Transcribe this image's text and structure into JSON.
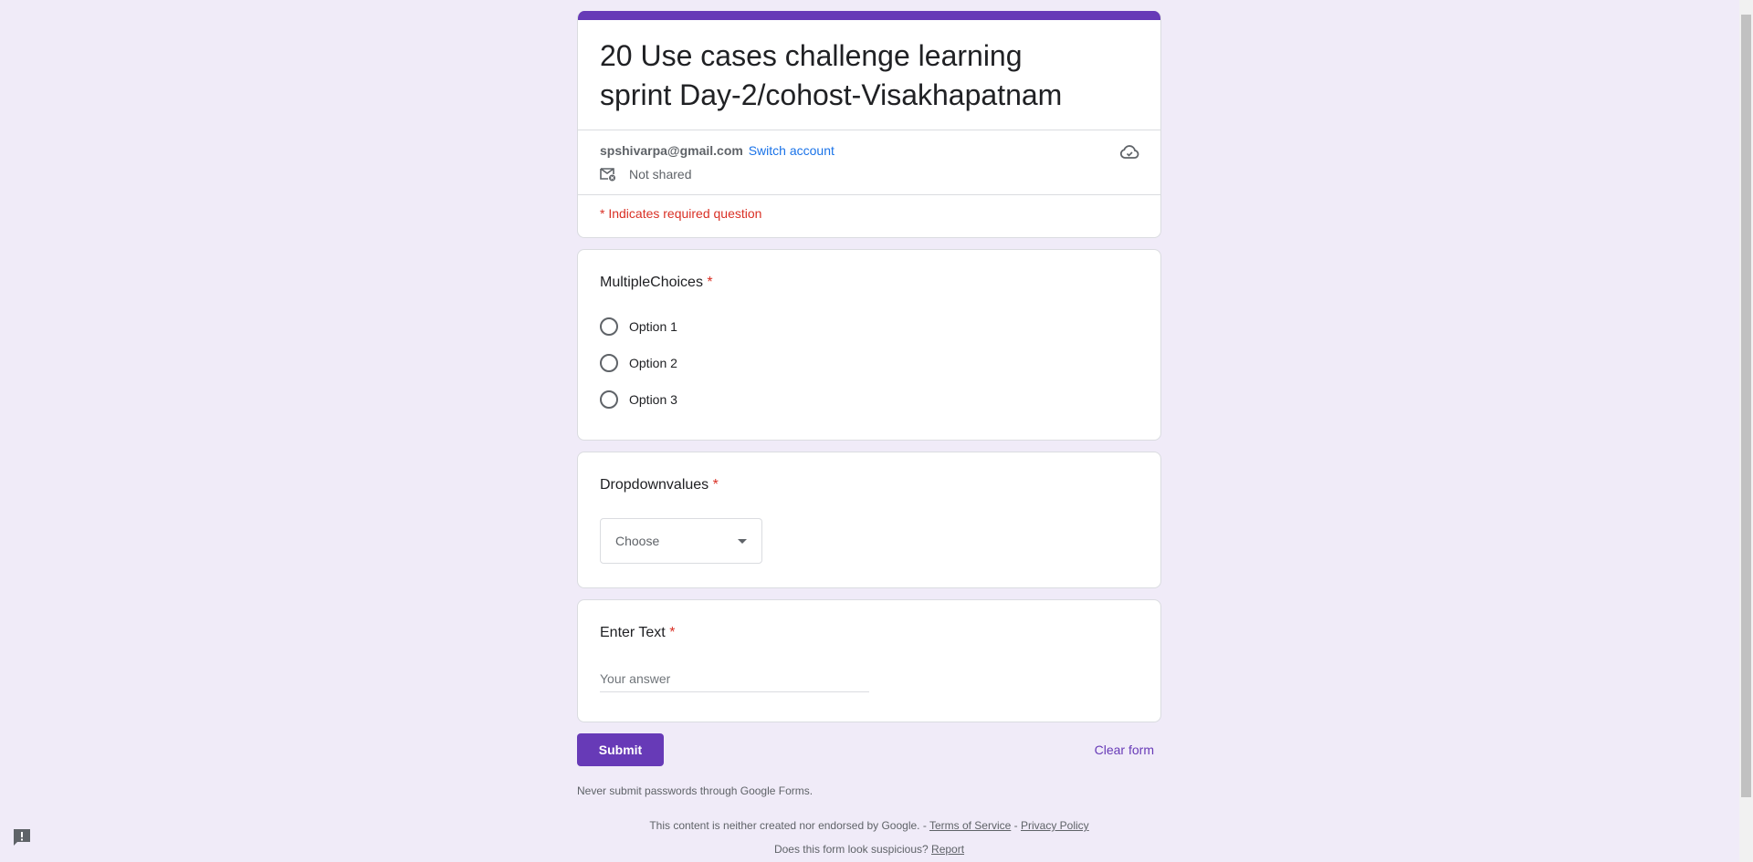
{
  "form": {
    "title": "20 Use cases challenge learning sprint Day-2/cohost-Visakhapatnam",
    "account_email": "spshivarpa@gmail.com",
    "switch_account": "Switch account",
    "shared_status": "Not shared",
    "required_note": "* Indicates required question",
    "accent_color": "#673ab7"
  },
  "questions": {
    "multiple": {
      "title": "MultipleChoices",
      "star": "*",
      "options": [
        "Option 1",
        "Option 2",
        "Option 3"
      ]
    },
    "dropdown": {
      "title": "Dropdownvalues",
      "star": "*",
      "placeholder": "Choose"
    },
    "text": {
      "title": "Enter Text",
      "star": "*",
      "placeholder": "Your answer"
    }
  },
  "actions": {
    "submit": "Submit",
    "clear": "Clear form"
  },
  "footer": {
    "never_note": "Never submit passwords through Google Forms.",
    "disclaimer": "This content is neither created nor endorsed by Google. -",
    "terms": "Terms of Service",
    "sep": "-",
    "privacy": "Privacy Policy",
    "suspicious": "Does this form look suspicious?",
    "report": "Report"
  },
  "icons": {
    "cloud": "cloud-icon",
    "mail": "mail-not-shared-icon",
    "report": "report-icon"
  }
}
